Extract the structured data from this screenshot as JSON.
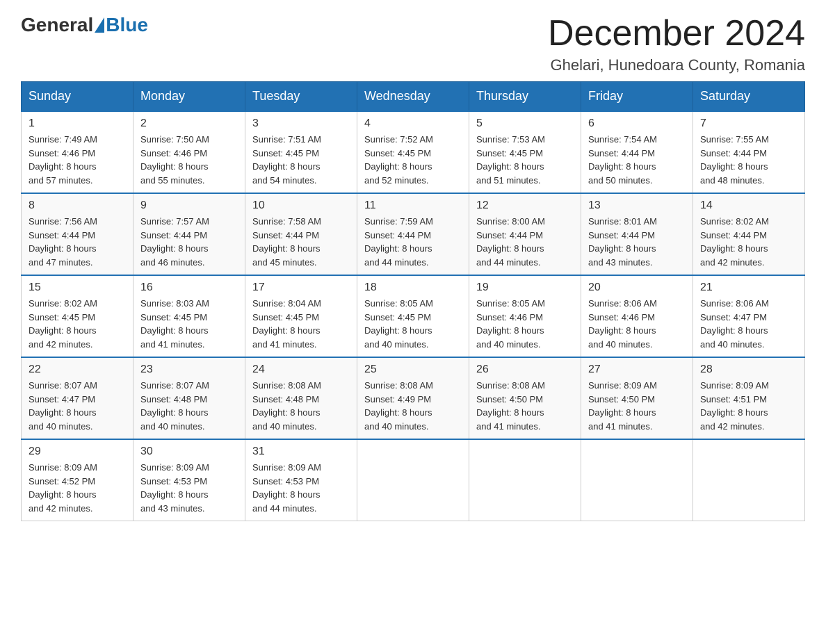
{
  "logo": {
    "general": "General",
    "blue": "Blue"
  },
  "title": "December 2024",
  "subtitle": "Ghelari, Hunedoara County, Romania",
  "weekdays": [
    "Sunday",
    "Monday",
    "Tuesday",
    "Wednesday",
    "Thursday",
    "Friday",
    "Saturday"
  ],
  "weeks": [
    [
      {
        "day": "1",
        "sunrise": "7:49 AM",
        "sunset": "4:46 PM",
        "daylight": "8 hours and 57 minutes."
      },
      {
        "day": "2",
        "sunrise": "7:50 AM",
        "sunset": "4:46 PM",
        "daylight": "8 hours and 55 minutes."
      },
      {
        "day": "3",
        "sunrise": "7:51 AM",
        "sunset": "4:45 PM",
        "daylight": "8 hours and 54 minutes."
      },
      {
        "day": "4",
        "sunrise": "7:52 AM",
        "sunset": "4:45 PM",
        "daylight": "8 hours and 52 minutes."
      },
      {
        "day": "5",
        "sunrise": "7:53 AM",
        "sunset": "4:45 PM",
        "daylight": "8 hours and 51 minutes."
      },
      {
        "day": "6",
        "sunrise": "7:54 AM",
        "sunset": "4:44 PM",
        "daylight": "8 hours and 50 minutes."
      },
      {
        "day": "7",
        "sunrise": "7:55 AM",
        "sunset": "4:44 PM",
        "daylight": "8 hours and 48 minutes."
      }
    ],
    [
      {
        "day": "8",
        "sunrise": "7:56 AM",
        "sunset": "4:44 PM",
        "daylight": "8 hours and 47 minutes."
      },
      {
        "day": "9",
        "sunrise": "7:57 AM",
        "sunset": "4:44 PM",
        "daylight": "8 hours and 46 minutes."
      },
      {
        "day": "10",
        "sunrise": "7:58 AM",
        "sunset": "4:44 PM",
        "daylight": "8 hours and 45 minutes."
      },
      {
        "day": "11",
        "sunrise": "7:59 AM",
        "sunset": "4:44 PM",
        "daylight": "8 hours and 44 minutes."
      },
      {
        "day": "12",
        "sunrise": "8:00 AM",
        "sunset": "4:44 PM",
        "daylight": "8 hours and 44 minutes."
      },
      {
        "day": "13",
        "sunrise": "8:01 AM",
        "sunset": "4:44 PM",
        "daylight": "8 hours and 43 minutes."
      },
      {
        "day": "14",
        "sunrise": "8:02 AM",
        "sunset": "4:44 PM",
        "daylight": "8 hours and 42 minutes."
      }
    ],
    [
      {
        "day": "15",
        "sunrise": "8:02 AM",
        "sunset": "4:45 PM",
        "daylight": "8 hours and 42 minutes."
      },
      {
        "day": "16",
        "sunrise": "8:03 AM",
        "sunset": "4:45 PM",
        "daylight": "8 hours and 41 minutes."
      },
      {
        "day": "17",
        "sunrise": "8:04 AM",
        "sunset": "4:45 PM",
        "daylight": "8 hours and 41 minutes."
      },
      {
        "day": "18",
        "sunrise": "8:05 AM",
        "sunset": "4:45 PM",
        "daylight": "8 hours and 40 minutes."
      },
      {
        "day": "19",
        "sunrise": "8:05 AM",
        "sunset": "4:46 PM",
        "daylight": "8 hours and 40 minutes."
      },
      {
        "day": "20",
        "sunrise": "8:06 AM",
        "sunset": "4:46 PM",
        "daylight": "8 hours and 40 minutes."
      },
      {
        "day": "21",
        "sunrise": "8:06 AM",
        "sunset": "4:47 PM",
        "daylight": "8 hours and 40 minutes."
      }
    ],
    [
      {
        "day": "22",
        "sunrise": "8:07 AM",
        "sunset": "4:47 PM",
        "daylight": "8 hours and 40 minutes."
      },
      {
        "day": "23",
        "sunrise": "8:07 AM",
        "sunset": "4:48 PM",
        "daylight": "8 hours and 40 minutes."
      },
      {
        "day": "24",
        "sunrise": "8:08 AM",
        "sunset": "4:48 PM",
        "daylight": "8 hours and 40 minutes."
      },
      {
        "day": "25",
        "sunrise": "8:08 AM",
        "sunset": "4:49 PM",
        "daylight": "8 hours and 40 minutes."
      },
      {
        "day": "26",
        "sunrise": "8:08 AM",
        "sunset": "4:50 PM",
        "daylight": "8 hours and 41 minutes."
      },
      {
        "day": "27",
        "sunrise": "8:09 AM",
        "sunset": "4:50 PM",
        "daylight": "8 hours and 41 minutes."
      },
      {
        "day": "28",
        "sunrise": "8:09 AM",
        "sunset": "4:51 PM",
        "daylight": "8 hours and 42 minutes."
      }
    ],
    [
      {
        "day": "29",
        "sunrise": "8:09 AM",
        "sunset": "4:52 PM",
        "daylight": "8 hours and 42 minutes."
      },
      {
        "day": "30",
        "sunrise": "8:09 AM",
        "sunset": "4:53 PM",
        "daylight": "8 hours and 43 minutes."
      },
      {
        "day": "31",
        "sunrise": "8:09 AM",
        "sunset": "4:53 PM",
        "daylight": "8 hours and 44 minutes."
      },
      null,
      null,
      null,
      null
    ]
  ],
  "labels": {
    "sunrise": "Sunrise:",
    "sunset": "Sunset:",
    "daylight": "Daylight:"
  }
}
